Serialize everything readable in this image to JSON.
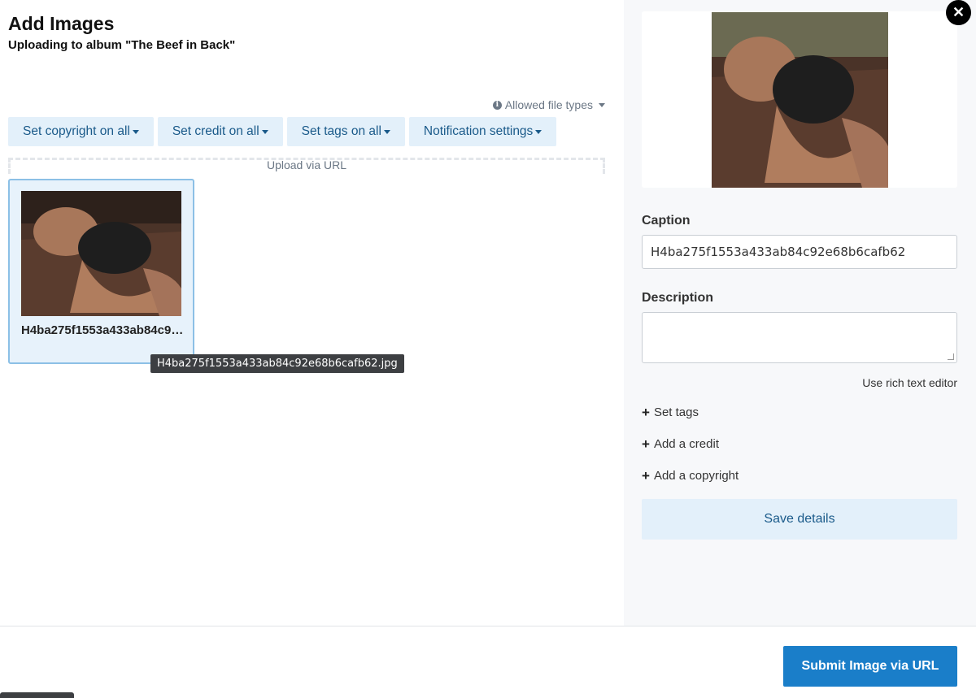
{
  "header": {
    "title": "Add Images",
    "subtitle": "Uploading to album \"The Beef in Back\""
  },
  "allowed_file_types": "Allowed file types",
  "toolbar": {
    "copyright": "Set copyright on all",
    "credit": "Set credit on all",
    "tags": "Set tags on all",
    "notifications": "Notification settings"
  },
  "upload_url_label": "Upload via URL",
  "thumbnail": {
    "name": "H4ba275f1553a433ab84c92e68b6cafb62",
    "tooltip": "H4ba275f1553a433ab84c92e68b6cafb62.jpg"
  },
  "details": {
    "caption_label": "Caption",
    "caption_value": "H4ba275f1553a433ab84c92e68b6cafb62",
    "description_label": "Description",
    "description_value": "",
    "rich_text": "Use rich text editor",
    "set_tags": "Set tags",
    "add_credit": "Add a credit",
    "add_copyright": "Add a copyright",
    "save": "Save details"
  },
  "close_glyph": "✕",
  "footer": {
    "submit": "Submit Image via URL"
  },
  "colors": {
    "accent": "#1a7ec9",
    "button_bg": "#e3f0fa",
    "button_text": "#1a5a8a"
  }
}
